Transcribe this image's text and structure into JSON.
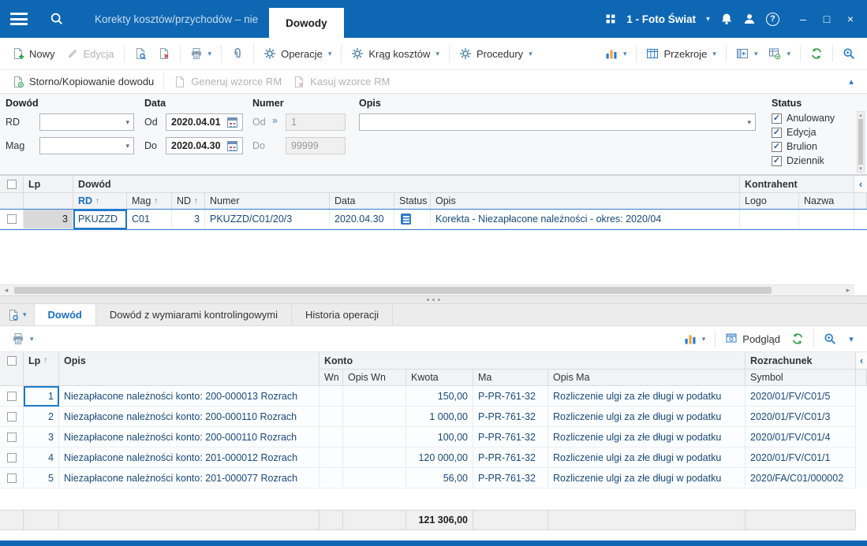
{
  "colors": {
    "titlebar_blue": "#0e67b2",
    "accent_blue": "#1a6fc0",
    "selection_blue": "#2f7fd6",
    "action_green": "#37a04c",
    "alert_red": "#cc4b4b"
  },
  "icons": {
    "chevron_down": "▾",
    "chevron_up": "▴",
    "collapse_left": "‹",
    "scroll_left": "◂",
    "scroll_right": "▸",
    "sort_asc": "↑",
    "check": "✓",
    "link_arrows": "»",
    "question": "?",
    "minimize": "–",
    "maximize": "□",
    "close": "×"
  },
  "titlebar": {
    "inactive_tab": "Korekty kosztów/przychodów – nie",
    "active_tab": "Dowody",
    "company": "1 - Foto Świat"
  },
  "toolbar": {
    "new": "Nowy",
    "edit": "Edycja",
    "operations": "Operacje",
    "cost_circle": "Krąg kosztów",
    "procedures": "Procedury",
    "sections": "Przekroje"
  },
  "actionbar": {
    "storno": "Storno/Kopiowanie dowodu",
    "generate_rm": "Generuj wzorce RM",
    "delete_rm": "Kasuj wzorce RM"
  },
  "filters": {
    "document_group": "Dowód",
    "rd_label": "RD",
    "mag_label": "Mag",
    "date_group": "Data",
    "from_label": "Od",
    "to_label": "Do",
    "date_from": "2020.04.01",
    "date_to": "2020.04.30",
    "number_group": "Numer",
    "number_from": "1",
    "number_to": "99999",
    "description_group": "Opis",
    "status_group": "Status",
    "statuses": [
      {
        "label": "Anulowany",
        "checked": true
      },
      {
        "label": "Edycja",
        "checked": true
      },
      {
        "label": "Brulion",
        "checked": true
      },
      {
        "label": "Dziennik",
        "checked": true
      }
    ]
  },
  "documents_grid": {
    "lp_header": "Lp",
    "document_group": "Dowód",
    "contractor_group": "Kontrahent",
    "columns": {
      "rd": "RD",
      "mag": "Mag",
      "nd": "ND",
      "numer": "Numer",
      "data": "Data",
      "status": "Status",
      "opis": "Opis",
      "logo": "Logo",
      "nazwa": "Nazwa"
    },
    "row": {
      "lp": "3",
      "rd": "PKUZZD",
      "mag": "C01",
      "nd": "3",
      "numer": "PKUZZD/C01/20/3",
      "data": "2020.04.30",
      "opis": "Korekta - Niezapłacone należności - okres: 2020/04"
    }
  },
  "detail_tabs": [
    "Dowód",
    "Dowód z wymiarami kontrolingowymi",
    "Historia operacji"
  ],
  "detail_toolbar": {
    "preview": "Podgląd"
  },
  "entries_grid": {
    "lp_header": "Lp",
    "opis_header": "Opis",
    "konto_group": "Konto",
    "rozrachunek_group": "Rozrachunek",
    "columns": {
      "wn": "Wn",
      "opis_wn": "Opis Wn",
      "kwota": "Kwota",
      "ma": "Ma",
      "opis_ma": "Opis Ma",
      "symbol": "Symbol"
    },
    "rows": [
      {
        "lp": "1",
        "opis": "Niezapłacone należności konto: 200-000013 Rozrach",
        "wn": "",
        "opis_wn": "",
        "kwota": "150,00",
        "ma": "P-PR-761-32",
        "opis_ma": "Rozliczenie ulgi za złe długi w podatku ",
        "symbol": "2020/01/FV/C01/5"
      },
      {
        "lp": "2",
        "opis": "Niezapłacone należności konto: 200-000110 Rozrach",
        "wn": "",
        "opis_wn": "",
        "kwota": "1 000,00",
        "ma": "P-PR-761-32",
        "opis_ma": "Rozliczenie ulgi za złe długi w podatku ",
        "symbol": "2020/01/FV/C01/3"
      },
      {
        "lp": "3",
        "opis": "Niezapłacone należności konto: 200-000110 Rozrach",
        "wn": "",
        "opis_wn": "",
        "kwota": "100,00",
        "ma": "P-PR-761-32",
        "opis_ma": "Rozliczenie ulgi za złe długi w podatku ",
        "symbol": "2020/01/FV/C01/4"
      },
      {
        "lp": "4",
        "opis": "Niezapłacone należności konto: 201-000012 Rozrach",
        "wn": "",
        "opis_wn": "",
        "kwota": "120 000,00",
        "ma": "P-PR-761-32",
        "opis_ma": "Rozliczenie ulgi za złe długi w podatku ",
        "symbol": "2020/01/FV/C01/1"
      },
      {
        "lp": "5",
        "opis": "Niezapłacone należności konto: 201-000077 Rozrach",
        "wn": "",
        "opis_wn": "",
        "kwota": "56,00",
        "ma": "P-PR-761-32",
        "opis_ma": "Rozliczenie ulgi za złe długi w podatku ",
        "symbol": "2020/FA/C01/000002"
      }
    ],
    "total_kwota": "121 306,00"
  }
}
